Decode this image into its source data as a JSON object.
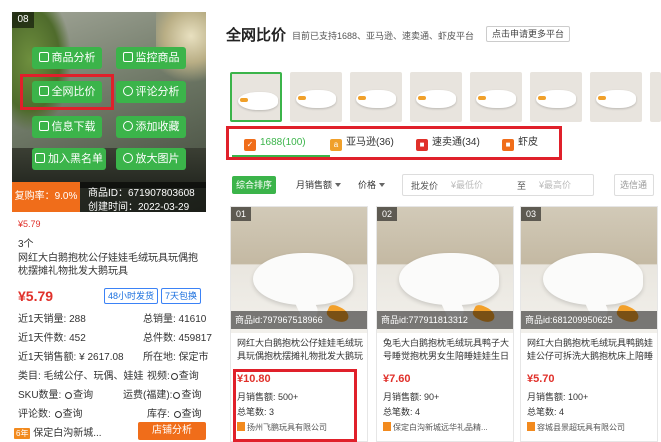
{
  "left_card": {
    "image_index": "08",
    "buttons": {
      "product_analysis": "商品分析",
      "monitor_product": "监控商品",
      "price_compare": "全网比价",
      "review_analysis": "评论分析",
      "info_download": "信息下载",
      "add_favorite": "添加收藏",
      "add_blacklist": "加入黑名单",
      "zoom_image": "放大图片"
    },
    "repurchase_rate": "复购率：9.0%",
    "product_id": "商品ID：671907803608",
    "created_time": "创建时间：2022-03-29",
    "small_price": "¥5.79",
    "count": "3个",
    "title": "网红大白鹅抱枕公仔娃娃毛绒玩具玩偶抱枕摆摊礼物批发大鹅玩具",
    "price": "¥5.79",
    "tag_ship": "48小时发货",
    "tag_return": "7天包换",
    "stats": {
      "sales_30d": "近1天销量: 288",
      "total_sales": "总销量: 41610",
      "orders_30d": "近1天件数: 452",
      "total_orders": "总件数: 459817",
      "revenue_30d": "近1天销售额: ¥ 2617.08",
      "location": "所在地: 保定市",
      "category": "类目: 毛绒公仔、玩偶、娃娃",
      "video": "视频:",
      "video_query": "查询",
      "sku": "SKU数量:",
      "sku_query": "查询",
      "freight": "运费(福建):",
      "freight_query": "查询",
      "reviews": "评论数:",
      "reviews_query": "查询",
      "stock": "库存:",
      "stock_query": "查询"
    },
    "shop_years": "6年",
    "shop_name": "保定白沟新城...",
    "shop_analysis": "店铺分析"
  },
  "panel": {
    "title": "全网比价",
    "subtitle": "目前已支持1688、亚马逊、速卖通、虾皮平台",
    "apply_button": "点击申请更多平台",
    "sources": [
      {
        "label": "1688(100)",
        "color": "#f06d1a",
        "icon": "1688-logo-icon"
      },
      {
        "label": "亚马逊(36)",
        "color": "#f0a02a",
        "icon": "amazon-logo-icon"
      },
      {
        "label": "速卖通(34)",
        "color": "#e0302a",
        "icon": "aliexpress-logo-icon"
      },
      {
        "label": "虾皮",
        "color": "#f06d1a",
        "icon": "shopee-logo-icon"
      }
    ],
    "sort": {
      "composite": "综合排序",
      "monthly_sales": "月销售额",
      "price": "价格"
    },
    "range": {
      "label": "批发价",
      "min_placeholder": "¥最低价",
      "to": "至",
      "max_placeholder": "¥最高价"
    },
    "filter_placeholder": "选信通",
    "results": [
      {
        "index": "01",
        "product_id": "商品id:797967518966",
        "title": "网红大白鹅抱枕公仔娃娃毛绒玩具玩偶抱枕摆摊礼物批发大鹅玩具",
        "price": "¥10.80",
        "monthly_sales": "月销售额: 500+",
        "total_reviews": "总笔数: 3",
        "shop": "扬州飞鹏玩具有限公司"
      },
      {
        "index": "02",
        "product_id": "商品id:777911813312",
        "title": "兔毛大白鹅抱枕毛绒玩具鸭子大号睡觉抱枕男女生陪睡娃娃生日礼物",
        "price": "¥7.60",
        "monthly_sales": "月销售额: 90+",
        "total_reviews": "总笔数: 4",
        "shop": "保定白沟新城远华礼品精..."
      },
      {
        "index": "03",
        "product_id": "商品id:681209950625",
        "title": "网红大白鹅抱枕毛绒玩具鸭鹅娃娃公仔可拆洗大鹅抱枕床上陪睡娃娃",
        "price": "¥5.70",
        "monthly_sales": "月销售额: 100+",
        "total_reviews": "总笔数: 4",
        "shop": "容城县景超玩具有限公司"
      }
    ]
  }
}
